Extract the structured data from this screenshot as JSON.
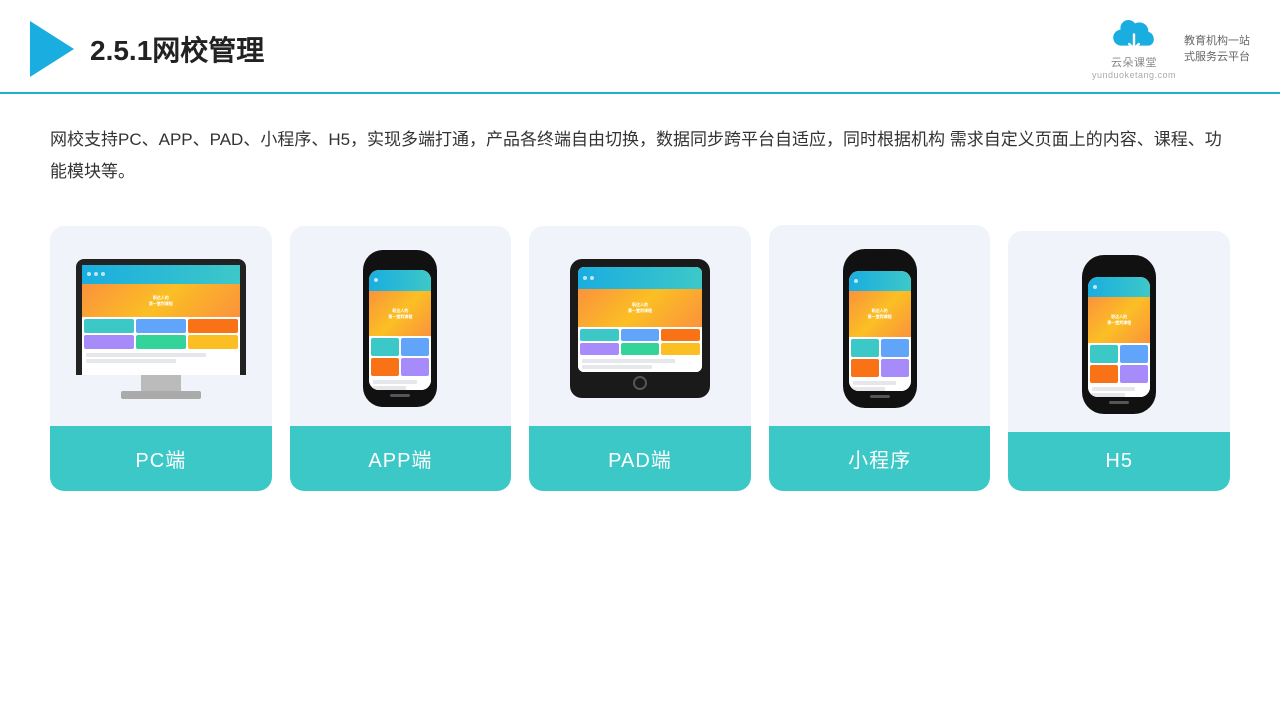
{
  "header": {
    "title": "2.5.1网校管理",
    "brand_name": "云朵课堂",
    "brand_url": "yunduoketang.com",
    "brand_tagline": "教育机构一站\n式服务云平台"
  },
  "description": "网校支持PC、APP、PAD、小程序、H5，实现多端打通，产品各终端自由切换，数据同步跨平台自适应，同时根据机构\n需求自定义页面上的内容、课程、功能模块等。",
  "cards": [
    {
      "id": "pc",
      "label": "PC端"
    },
    {
      "id": "app",
      "label": "APP端"
    },
    {
      "id": "pad",
      "label": "PAD端"
    },
    {
      "id": "miniapp",
      "label": "小程序"
    },
    {
      "id": "h5",
      "label": "H5"
    }
  ],
  "colors": {
    "accent": "#1aade0",
    "teal": "#3dc8c8",
    "card_bg": "#f0f4fa"
  }
}
